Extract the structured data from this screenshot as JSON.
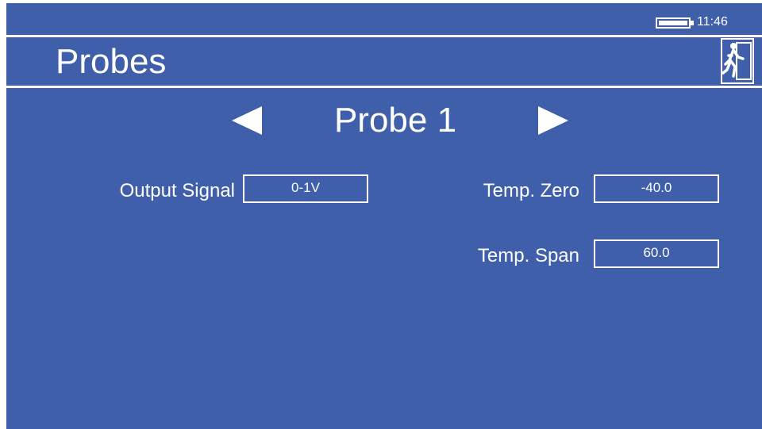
{
  "status": {
    "battery_level": 1.0,
    "time": "11:46"
  },
  "header": {
    "title": "Probes",
    "exit_icon": "emergency-exit-icon"
  },
  "probe_selector": {
    "prev_icon": "triangle-left-icon",
    "current": "Probe 1",
    "next_icon": "triangle-right-icon"
  },
  "fields": {
    "output_signal": {
      "label": "Output Signal",
      "value": "0-1V"
    },
    "temp_zero": {
      "label": "Temp. Zero",
      "value": "-40.0"
    },
    "temp_span": {
      "label": "Temp. Span",
      "value": "60.0"
    }
  },
  "colors": {
    "background": "#3f5fab",
    "foreground": "#ffffff"
  }
}
